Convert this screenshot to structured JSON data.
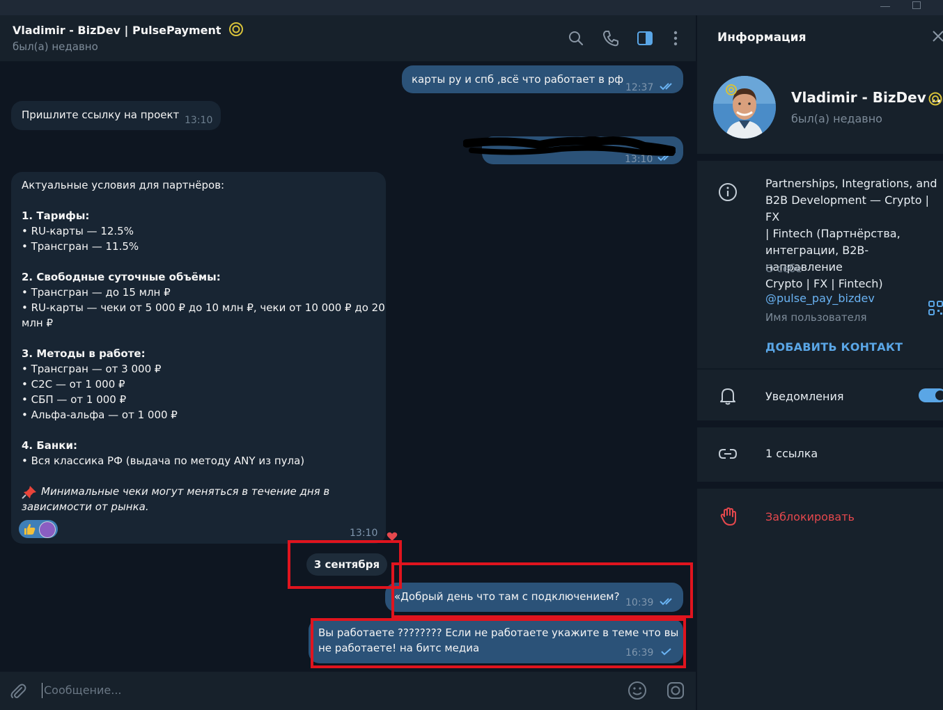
{
  "header": {
    "title": "Vladimir - BizDev | PulsePayment",
    "status": "был(а) недавно"
  },
  "messages": [
    {
      "dir": "out",
      "text": "карты ру и спб ,всё что работает в рф",
      "time": "12:37",
      "read": true
    },
    {
      "dir": "in",
      "text": "Пришлите ссылку на проект",
      "time": "13:10"
    },
    {
      "dir": "out",
      "text": "",
      "time": "13:10",
      "read": true,
      "redacted": true
    },
    {
      "dir": "in",
      "time": "13:10",
      "reaction": "heart"
    },
    {
      "dir": "out",
      "text": "«Добрый день что там с подключением?",
      "time": "10:39",
      "read": true
    },
    {
      "dir": "out",
      "text_line1": "Вы работаете ???????? Если не работаете укажите в теме что вы",
      "text_line2": "не работаете!  на битс медиа",
      "time": "16:39",
      "read": false
    }
  ],
  "long_message": {
    "intro": "Актуальные условия для партнёров:",
    "s1_title": "1. Тарифы:",
    "s1_l1": "• RU-карты — 12.5%",
    "s1_l2": "• Трансгран — 11.5%",
    "s2_title": "2. Свободные суточные объёмы:",
    "s2_l1": "• Трансгран — до 15 млн ₽",
    "s2_l2": "• RU-карты — чеки от 5 000 ₽ до 10 млн ₽, чеки от 10 000 ₽ до 20",
    "s2_l3": "млн ₽",
    "s3_title": "3. Методы в работе:",
    "s3_l1": "• Трансгран — от 3 000 ₽",
    "s3_l2": "• C2C — от 1 000 ₽",
    "s3_l3": "• СБП — от 1 000 ₽",
    "s3_l4": "• Альфа-альфа — от 1 000 ₽",
    "s4_title": "4. Банки:",
    "s4_l1": "• Вся классика РФ (выдача по методу ANY из пула)",
    "note_l1": "Минимальные чеки могут меняться в течение дня в",
    "note_l2": "зависимости от рынка.",
    "time": "13:10",
    "reactions": [
      "thumbs-up",
      "avatar"
    ]
  },
  "date_separator": "3 сентября",
  "composer": {
    "placeholder": "Сообщение..."
  },
  "info_panel": {
    "title": "Информация",
    "name": "Vladimir - BizDev ...",
    "status": "был(а) недавно",
    "about_l1": "Partnerships, Integrations, and",
    "about_l2": "B2B Development — Crypto | FX",
    "about_l3": "| Fintech (Партнёрства,",
    "about_l4": "интеграции, B2B-направление",
    "about_l5": "Crypto | FX | Fintech)",
    "about_label": "О себе",
    "username": "@pulse_pay_bizdev",
    "username_label": "Имя пользователя",
    "add_contact": "ДОБАВИТЬ КОНТАКТ",
    "notifications": "Уведомления",
    "notifications_on": true,
    "links": "1 ссылка",
    "block": "Заблокировать"
  },
  "colors": {
    "bg": "#0e1621",
    "panel": "#17212b",
    "incoming": "#182533",
    "outgoing": "#2b5278",
    "accent": "#5aa6e6",
    "danger": "#e5484d",
    "highlight": "#e0141e"
  }
}
